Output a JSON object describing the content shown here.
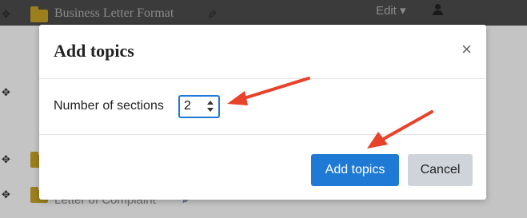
{
  "background": {
    "course_title": "Business Letter Format",
    "edit_menu": "Edit",
    "section_link": "Letter of Complaint"
  },
  "modal": {
    "title": "Add topics",
    "field_label": "Number of sections",
    "field_value": "2",
    "primary_button": "Add topics",
    "secondary_button": "Cancel",
    "close_glyph": "×"
  },
  "colors": {
    "accent": "#1f7ad6",
    "annotation_arrow": "#e8422a",
    "secondary_button": "#ced4da"
  },
  "icons": [
    "pencil-icon",
    "folder-icon",
    "user-icon",
    "move-icon",
    "close-icon",
    "chevron-up-icon",
    "chevron-down-icon"
  ]
}
